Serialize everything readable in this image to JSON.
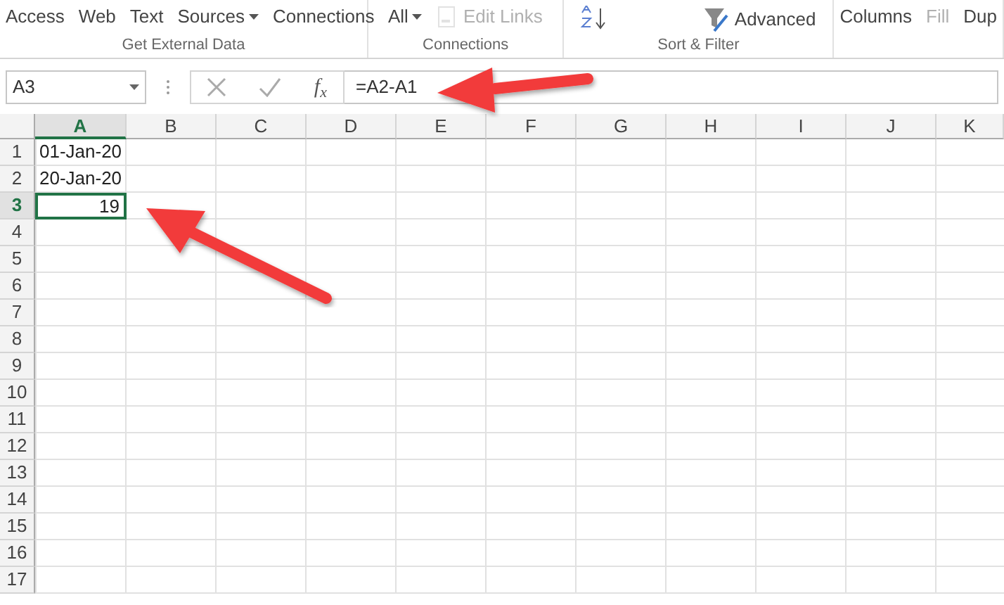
{
  "ribbon": {
    "groups": [
      {
        "label": "Get External Data",
        "items": [
          {
            "kind": "text",
            "label": "Access",
            "disabled": false
          },
          {
            "kind": "text",
            "label": "Web",
            "disabled": false
          },
          {
            "kind": "text",
            "label": "Text",
            "disabled": false
          },
          {
            "kind": "dropdown",
            "label": "Sources",
            "disabled": false
          },
          {
            "kind": "text",
            "label": "Connections",
            "disabled": false
          }
        ]
      },
      {
        "label": "Connections",
        "items": [
          {
            "kind": "dropdown",
            "label": "All",
            "disabled": false
          },
          {
            "kind": "links",
            "label": "Edit Links",
            "disabled": true
          }
        ]
      },
      {
        "label": "Sort & Filter",
        "items": [
          {
            "kind": "sort",
            "disabled": false
          },
          {
            "kind": "filter",
            "label": "Advanced",
            "disabled": false
          }
        ]
      },
      {
        "items": [
          {
            "kind": "text",
            "label": "Columns",
            "disabled": false
          },
          {
            "kind": "text",
            "label": "Fill",
            "disabled": true
          },
          {
            "kind": "text",
            "label": "Dup",
            "disabled": false
          }
        ]
      }
    ]
  },
  "name_box": {
    "value": "A3"
  },
  "formula_bar": {
    "function_button": "f$_{x}$",
    "value": "=A2-A1"
  },
  "sheet": {
    "columns": [
      {
        "label": "A",
        "selected": true
      },
      {
        "label": "B",
        "selected": false
      },
      {
        "label": "C",
        "selected": false
      },
      {
        "label": "D",
        "selected": false
      },
      {
        "label": "E",
        "selected": false
      },
      {
        "label": "F",
        "selected": false
      },
      {
        "label": "G",
        "selected": false
      },
      {
        "label": "H",
        "selected": false
      },
      {
        "label": "I",
        "selected": false
      },
      {
        "label": "J",
        "selected": false
      },
      {
        "label": "K",
        "selected": false
      }
    ],
    "rows": [
      {
        "label": "1",
        "selected": false,
        "cells": [
          {
            "kind": "text",
            "value": "01-Jan-20",
            "selected": false
          }
        ]
      },
      {
        "label": "2",
        "selected": false,
        "cells": [
          {
            "kind": "text",
            "value": "20-Jan-20",
            "selected": false
          }
        ]
      },
      {
        "label": "3",
        "selected": true,
        "cells": [
          {
            "kind": "number",
            "value": "19",
            "selected": true
          }
        ]
      },
      {
        "label": "4",
        "selected": false,
        "cells": []
      },
      {
        "label": "5",
        "selected": false,
        "cells": []
      },
      {
        "label": "6",
        "selected": false,
        "cells": []
      },
      {
        "label": "7",
        "selected": false,
        "cells": []
      },
      {
        "label": "8",
        "selected": false,
        "cells": []
      },
      {
        "label": "9",
        "selected": false,
        "cells": []
      },
      {
        "label": "10",
        "selected": false,
        "cells": []
      },
      {
        "label": "11",
        "selected": false,
        "cells": []
      },
      {
        "label": "12",
        "selected": false,
        "cells": []
      },
      {
        "label": "13",
        "selected": false,
        "cells": []
      },
      {
        "label": "14",
        "selected": false,
        "cells": []
      },
      {
        "label": "15",
        "selected": false,
        "cells": []
      },
      {
        "label": "16",
        "selected": false,
        "cells": []
      },
      {
        "label": "17",
        "selected": false,
        "cells": []
      }
    ]
  }
}
